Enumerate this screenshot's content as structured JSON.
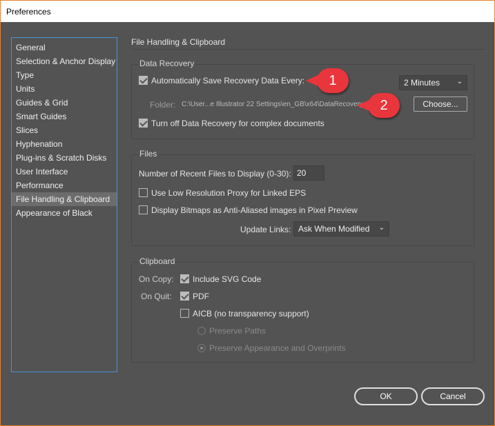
{
  "window": {
    "title": "Preferences"
  },
  "sidebar": {
    "items": [
      {
        "label": "General"
      },
      {
        "label": "Selection & Anchor Display"
      },
      {
        "label": "Type"
      },
      {
        "label": "Units"
      },
      {
        "label": "Guides & Grid"
      },
      {
        "label": "Smart Guides"
      },
      {
        "label": "Slices"
      },
      {
        "label": "Hyphenation"
      },
      {
        "label": "Plug-ins & Scratch Disks"
      },
      {
        "label": "User Interface"
      },
      {
        "label": "Performance"
      },
      {
        "label": "File Handling & Clipboard",
        "selected": true
      },
      {
        "label": "Appearance of Black"
      }
    ]
  },
  "main": {
    "heading": "File Handling & Clipboard",
    "data_recovery": {
      "title": "Data Recovery",
      "auto_save_label": "Automatically Save Recovery Data Every:",
      "auto_save_checked": true,
      "interval": "2 Minutes",
      "folder_label": "Folder:",
      "folder_path": "C:\\User...e Illustrator 22 Settings\\en_GB\\x64\\DataRecovery",
      "choose_label": "Choose...",
      "turn_off_label": "Turn off Data Recovery for complex documents",
      "turn_off_checked": true
    },
    "files": {
      "title": "Files",
      "recent_label": "Number of Recent Files to Display (0-30):",
      "recent_value": "20",
      "low_res_label": "Use Low Resolution Proxy for Linked EPS",
      "low_res_checked": false,
      "bitmaps_label": "Display Bitmaps as Anti-Aliased images in Pixel Preview",
      "bitmaps_checked": false,
      "update_links_label": "Update Links:",
      "update_links_value": "Ask When Modified"
    },
    "clipboard": {
      "title": "Clipboard",
      "on_copy_label": "On Copy:",
      "svg_label": "Include SVG Code",
      "on_quit_label": "On Quit:",
      "pdf_label": "PDF",
      "aicb_label": "AICB (no transparency support)",
      "preserve_paths_label": "Preserve Paths",
      "preserve_appearance_label": "Preserve Appearance and Overprints"
    }
  },
  "callouts": {
    "one": "1",
    "two": "2"
  },
  "footer": {
    "ok": "OK",
    "cancel": "Cancel"
  },
  "colors": {
    "accent_border": "#e8812b",
    "callout": "#e8363c",
    "selection_border": "#4a90d9"
  }
}
